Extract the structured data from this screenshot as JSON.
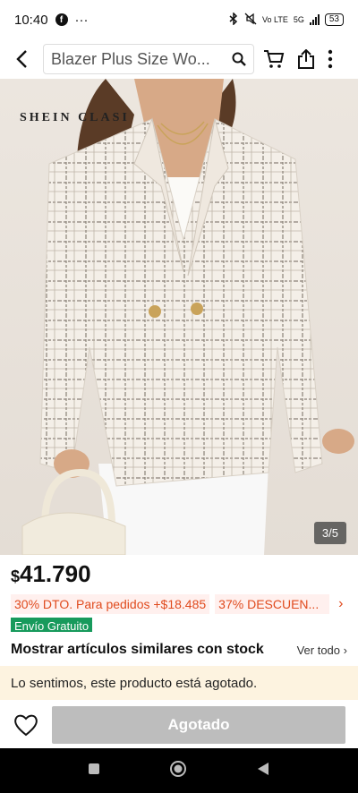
{
  "status": {
    "time": "10:40",
    "battery": "53",
    "network": "5G",
    "volte": "Vo LTE"
  },
  "header": {
    "search_text": "Blazer Plus Size Wo..."
  },
  "image": {
    "brand": "SHEIN CLASI",
    "counter": "3/5"
  },
  "product": {
    "currency": "$",
    "price": "41.790",
    "promo1": "30% DTO. Para pedidos +$18.485",
    "promo2": "37% DESCUEN...",
    "shipping": "Envío Gratuito"
  },
  "similar": {
    "title": "Mostrar artículos similares con stock",
    "link": "Ver todo"
  },
  "notice": "Lo sentimos, este producto está agotado.",
  "actions": {
    "soldout_label": "Agotado"
  },
  "colors": {
    "accent": "#e04b1e",
    "ship_green": "#179a5c",
    "disabled": "#bdbdbd",
    "notice_bg": "#fdf3e0"
  }
}
